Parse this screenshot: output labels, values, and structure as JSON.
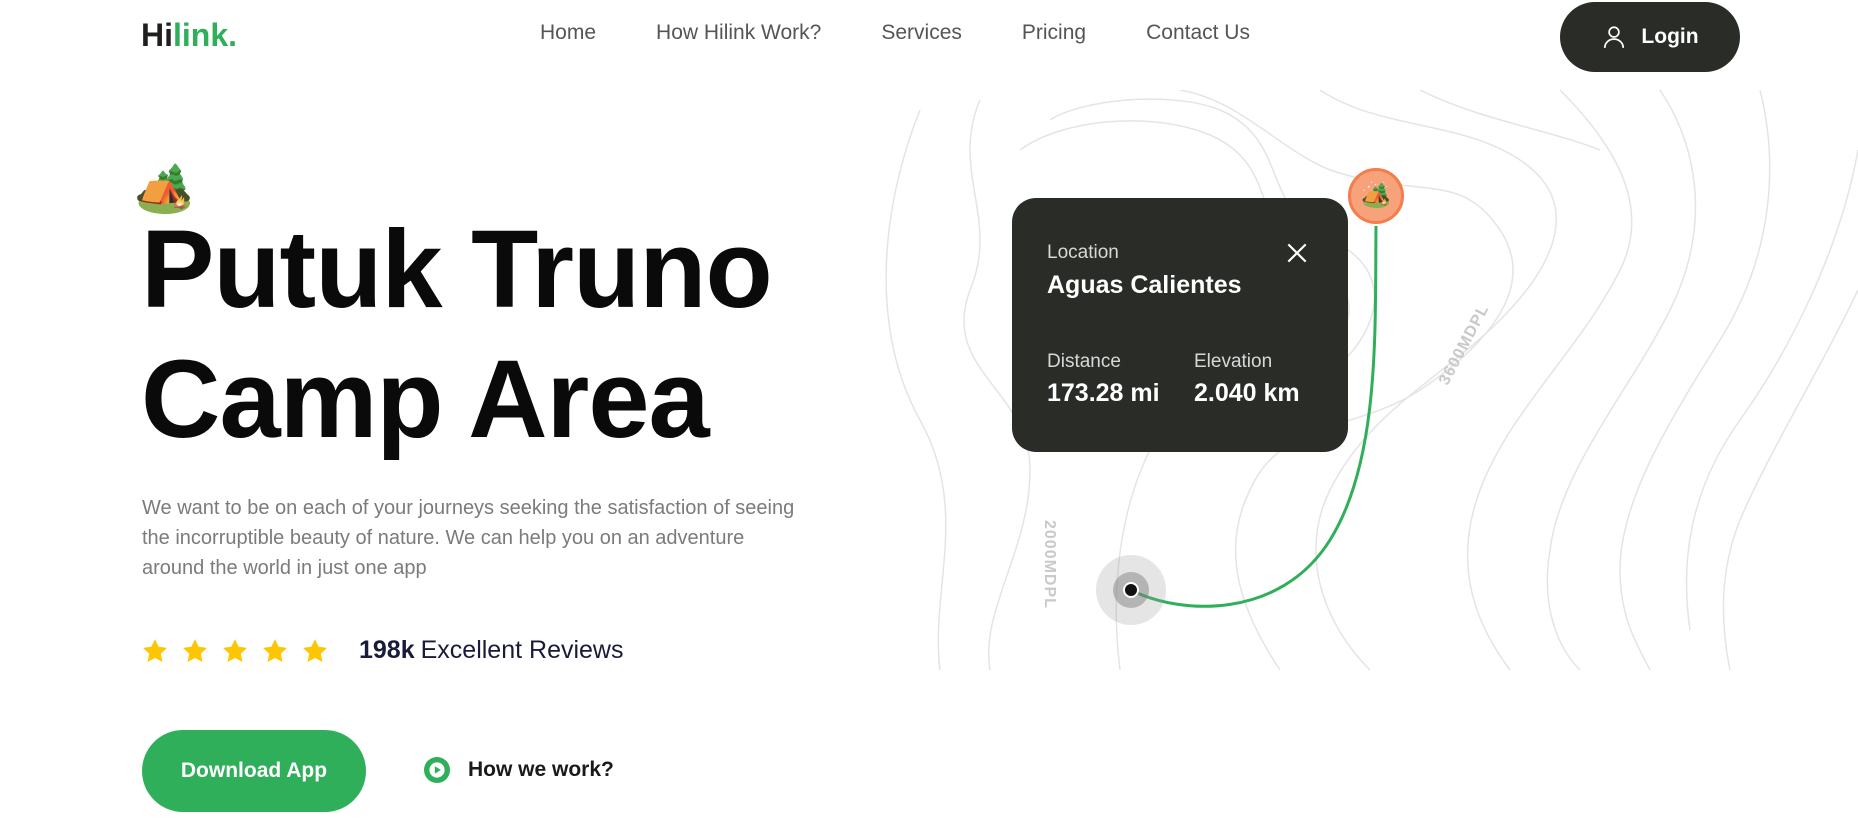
{
  "header": {
    "logo_part1": "Hi",
    "logo_part2": "link.",
    "nav": [
      {
        "label": "Home"
      },
      {
        "label": "How Hilink Work?"
      },
      {
        "label": "Services"
      },
      {
        "label": "Pricing"
      },
      {
        "label": "Contact Us"
      }
    ],
    "login_label": "Login"
  },
  "hero": {
    "title_line1": "Putuk Truno",
    "title_line2": "Camp Area",
    "description": "We want to be on each of your journeys seeking the satisfaction of seeing the incorruptible beauty of nature. We can help you on an adventure around the world in just one app",
    "rating": {
      "stars": 5,
      "count": "198k",
      "label": "Excellent Reviews"
    },
    "download_label": "Download App",
    "how_label": "How we work?"
  },
  "map": {
    "card": {
      "location_label": "Location",
      "location_value": "Aguas Calientes",
      "distance_label": "Distance",
      "distance_value": "173.28 mi",
      "elevation_label": "Elevation",
      "elevation_value": "2.040 km"
    },
    "contour_label_1": "3600MDPL",
    "contour_label_2": "2000MDPL"
  },
  "colors": {
    "brand_green": "#30af5b",
    "dark": "#292c27",
    "star": "#fec601",
    "pin": "#f7a27a"
  },
  "icons": {
    "camp": "camping-tent-icon",
    "login": "user-icon",
    "close": "close-icon",
    "play": "play-circle-icon",
    "star": "star-icon"
  }
}
